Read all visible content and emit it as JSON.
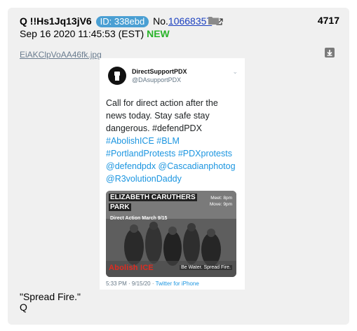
{
  "post": {
    "trip": "Q !!Hs1Jq13jV6",
    "id_label": "ID: 338ebd",
    "no_prefix": "No.",
    "no_value": "10668357",
    "post_number": "4717",
    "date": "Sep 16 2020 11:45:53 (EST)",
    "new_label": "NEW",
    "filename": "EiAKClpVoAA46fk.jpg",
    "message_lines": [
      "\"Spread Fire.\"",
      "Q"
    ]
  },
  "tweet": {
    "name": "DirectSupportPDX",
    "handle": "@DAsupportPDX",
    "lines": [
      {
        "text": "Call for direct action after the",
        "kind": "plain"
      },
      {
        "text": "news today. Stay safe stay",
        "kind": "plain"
      },
      {
        "text": "dangerous. #defendPDX",
        "kind": "plain"
      },
      {
        "text": "#AbolishICE #BLM",
        "kind": "link"
      },
      {
        "text": "#PortlandProtests #PDXprotests",
        "kind": "link"
      },
      {
        "text": "@defendpdx @Cascadianphotog",
        "kind": "link"
      },
      {
        "text": "@R3volutionDaddy",
        "kind": "link"
      }
    ],
    "image": {
      "title_line1": "ELIZABETH CARUTHERS",
      "title_line2": "PARK",
      "event": "Direct Action March 9/15",
      "meet": "Meet: 8pm",
      "move": "Move: 9pm",
      "abolish": "Abolish ICE",
      "tagline": "Be Water. Spread Fire."
    },
    "time": "5:33 PM · 9/15/20 · ",
    "client": "Twitter for iPhone"
  },
  "colors": {
    "post_bg": "#f0f0f0",
    "id_badge": "#4a9fd3",
    "new_green": "#29b329",
    "link_blue": "#1b95e0"
  }
}
